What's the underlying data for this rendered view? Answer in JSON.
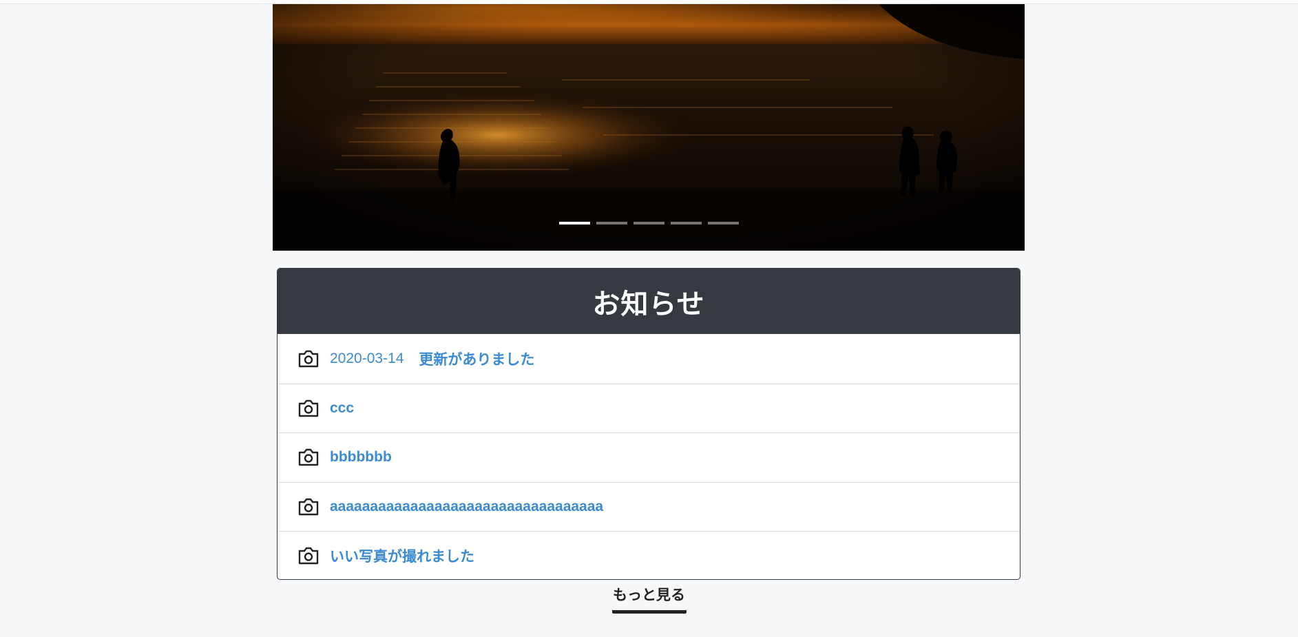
{
  "carousel": {
    "slide_count": 5,
    "active_index": 0
  },
  "news": {
    "title": "お知らせ",
    "items": [
      {
        "date": "2020-03-14",
        "text": "更新がありました",
        "icon": "camera-icon"
      },
      {
        "date": "",
        "text": "ccc",
        "icon": "camera-icon"
      },
      {
        "date": "",
        "text": "bbbbbbb",
        "icon": "camera-icon"
      },
      {
        "date": "",
        "text": "aaaaaaaaaaaaaaaaaaaaaaaaaaaaaaaaaa",
        "icon": "camera-icon"
      },
      {
        "date": "",
        "text": "いい写真が撮れました",
        "icon": "camera-icon"
      }
    ]
  },
  "more": {
    "label": "もっと見る"
  },
  "colors": {
    "header_bg": "#343a40",
    "link": "#3b8ad4",
    "page_bg": "#f7f8fa"
  }
}
